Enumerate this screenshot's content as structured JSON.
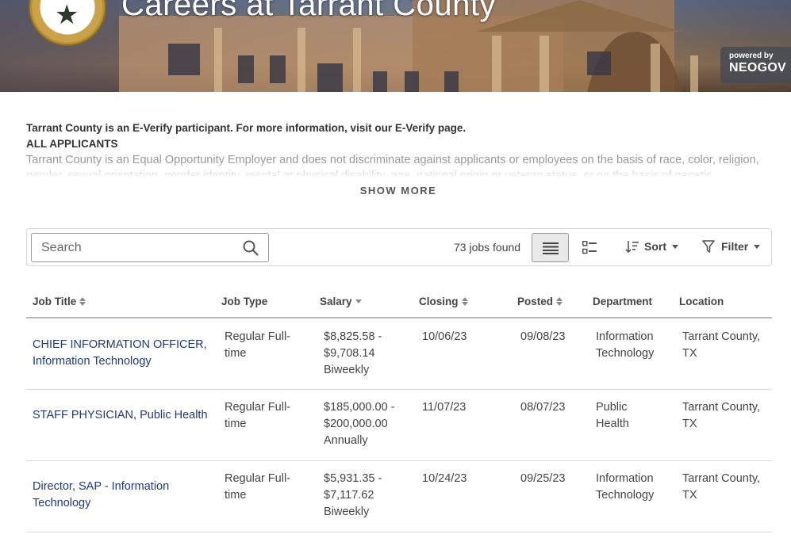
{
  "hero": {
    "title": "Careers at Tarrant County",
    "powered_by": "powered by",
    "brand": "NEOGOV"
  },
  "intro": {
    "line1": "Tarrant County is an E-Verify participant. For more information, visit our E-Verify page.",
    "line2": "ALL APPLICANTS",
    "body": "Tarrant County is an Equal Opportunity Employer and does not discriminate against applicants or employees on the basis of race, color, religion, gender, sexual orientation, gender identity, mental or physical disability, age, national origin or veteran status, or on the basis of genetic",
    "show_more": "SHOW MORE"
  },
  "toolbar": {
    "search_placeholder": "Search",
    "jobs_found": "73 jobs found",
    "sort_label": "Sort",
    "filter_label": "Filter"
  },
  "table": {
    "headers": {
      "title": "Job Title",
      "type": "Job Type",
      "salary": "Salary",
      "closing": "Closing",
      "posted": "Posted",
      "department": "Department",
      "location": "Location"
    },
    "rows": [
      {
        "title_line1": "CHIEF INFORMATION OFFICER,",
        "title_line2": "Information Technology",
        "type_line1": "Regular Full-",
        "type_line2": "time",
        "salary_line1": "$8,825.58 -",
        "salary_line2": "$9,708.14",
        "salary_line3": "Biweekly",
        "closing": "10/06/23",
        "posted": "09/08/23",
        "dept_line1": "Information",
        "dept_line2": "Technology",
        "loc_line1": "Tarrant County,",
        "loc_line2": "TX"
      },
      {
        "title_line1": "STAFF PHYSICIAN, Public Health",
        "title_line2": "",
        "type_line1": "Regular Full-",
        "type_line2": "time",
        "salary_line1": "$185,000.00 -",
        "salary_line2": "$200,000.00",
        "salary_line3": "Annually",
        "closing": "11/07/23",
        "posted": "08/07/23",
        "dept_line1": "Public",
        "dept_line2": "Health",
        "loc_line1": "Tarrant County,",
        "loc_line2": "TX"
      },
      {
        "title_line1": "Director, SAP - Information",
        "title_line2": "Technology",
        "type_line1": "Regular Full-",
        "type_line2": "time",
        "salary_line1": "$5,931.35 -",
        "salary_line2": "$7,117.62",
        "salary_line3": "Biweekly",
        "closing": "10/24/23",
        "posted": "09/25/23",
        "dept_line1": "Information",
        "dept_line2": "Technology",
        "loc_line1": "Tarrant County,",
        "loc_line2": "TX"
      }
    ]
  },
  "colors": {
    "link": "#1f3a7a",
    "text": "#333333",
    "muted": "#999999"
  }
}
